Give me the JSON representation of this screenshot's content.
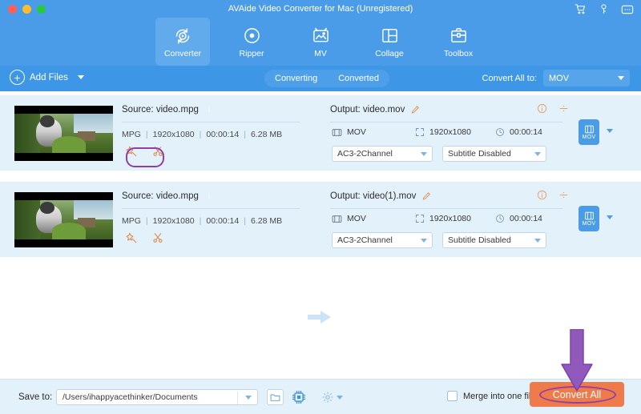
{
  "window": {
    "title": "AVAide Video Converter for Mac (Unregistered)",
    "traffic_lights": [
      "close",
      "minimize",
      "maximize"
    ],
    "title_icons": [
      {
        "name": "cart-icon",
        "glyph": "Ὥ2"
      },
      {
        "name": "key-icon",
        "glyph": "key"
      },
      {
        "name": "menu-icon",
        "glyph": "menu"
      }
    ]
  },
  "nav": {
    "items": [
      {
        "label": "Converter",
        "icon": "converter-icon",
        "active": true
      },
      {
        "label": "Ripper",
        "icon": "ripper-icon",
        "active": false
      },
      {
        "label": "MV",
        "icon": "mv-icon",
        "active": false
      },
      {
        "label": "Collage",
        "icon": "collage-icon",
        "active": false
      },
      {
        "label": "Toolbox",
        "icon": "toolbox-icon",
        "active": false
      }
    ]
  },
  "toolbar": {
    "add_files_label": "Add Files",
    "tabs": [
      {
        "label": "Converting",
        "active": false
      },
      {
        "label": "Converted",
        "active": true,
        "annotated": true
      }
    ],
    "convert_all_to_label": "Convert All to:",
    "convert_all_to_value": "MOV"
  },
  "files": [
    {
      "source": {
        "label": "Source: video.mpg",
        "format": "MPG",
        "resolution": "1920x1080",
        "duration": "00:00:14",
        "size": "6.28 MB",
        "sep": "|",
        "actions": [
          {
            "name": "edit-icon",
            "label": "Edit"
          },
          {
            "name": "trim-icon",
            "label": "Trim"
          }
        ],
        "annotated_actions": true
      },
      "output": {
        "label": "Output: video.mov",
        "format": "MOV",
        "resolution": "1920x1080",
        "duration": "00:00:14",
        "audio_track": "AC3-2Channel",
        "subtitle_track": "Subtitle Disabled",
        "format_badge": "MOV"
      }
    },
    {
      "source": {
        "label": "Source: video.mpg",
        "format": "MPG",
        "resolution": "1920x1080",
        "duration": "00:00:14",
        "size": "6.28 MB",
        "sep": "|",
        "actions": [
          {
            "name": "edit-icon",
            "label": "Edit"
          },
          {
            "name": "trim-icon",
            "label": "Trim"
          }
        ],
        "annotated_actions": false
      },
      "output": {
        "label": "Output: video(1).mov",
        "format": "MOV",
        "resolution": "1920x1080",
        "duration": "00:00:14",
        "audio_track": "AC3-2Channel",
        "subtitle_track": "Subtitle Disabled",
        "format_badge": "MOV"
      }
    }
  ],
  "bottom": {
    "save_to_label": "Save to:",
    "save_to_path": "/Users/ihappyacethinker/Documents",
    "merge_label": "Merge into one file",
    "merge_checked": false,
    "convert_button_label": "Convert All"
  },
  "annotations": {
    "highlight_color": "#8e3fa8",
    "tab_highlight_color": "#a8368f",
    "arrow_color": "#8e57b8",
    "arrow_target": "Convert All"
  },
  "colors": {
    "titlebar_blue": "#4a9ce8",
    "toolbar_blue": "#3d96e6",
    "row_blue": "#e3f1fb",
    "accent_orange": "#ef7a4a",
    "icon_orange": "#e08a4a"
  }
}
